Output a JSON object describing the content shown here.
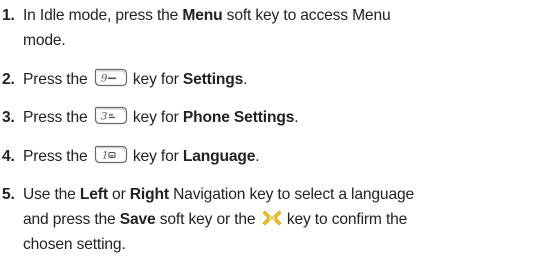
{
  "steps": [
    {
      "number": "1.",
      "t1": "In Idle mode, press the ",
      "b1": "Menu",
      "t2": " soft key to access Menu",
      "t3": "mode."
    },
    {
      "number": "2.",
      "t1": "Press the",
      "key_icon": "key-9-icon",
      "key_glyph": "9",
      "t2": "key for ",
      "b1": "Settings",
      "t3": "."
    },
    {
      "number": "3.",
      "t1": "Press the",
      "key_icon": "key-3-icon",
      "key_glyph": "3",
      "t2": "key for ",
      "b1": "Phone Settings",
      "t3": "."
    },
    {
      "number": "4.",
      "t1": "Press the",
      "key_icon": "key-1-icon",
      "key_glyph": "1",
      "t2": "key for ",
      "b1": "Language",
      "t3": "."
    },
    {
      "number": "5.",
      "t1": "Use the ",
      "b1": "Left",
      "t2": " or ",
      "b2": "Right",
      "t3": " Navigation key to select a language",
      "t4": "and press the ",
      "b3": "Save",
      "t5": " soft key or the",
      "key_icon": "navigation-ok-key-icon",
      "t6": "key to confirm the",
      "t7": "chosen setting."
    }
  ],
  "colors": {
    "text": "#222222",
    "key_border": "#6a6a6a",
    "nav_key": "#f4c21b"
  }
}
